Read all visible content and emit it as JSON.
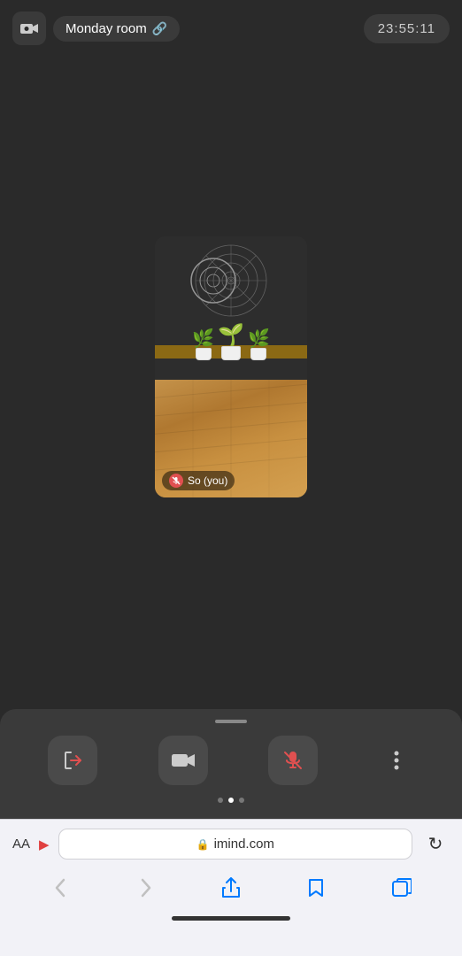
{
  "header": {
    "room_name": "Monday room",
    "time": "23:55:11",
    "camera_icon": "camera-icon",
    "link_icon": "🔗"
  },
  "video": {
    "user_name": "So  (you)",
    "muted": true,
    "mic_icon": "mic-muted-icon"
  },
  "controls": {
    "leave_label": "leave-icon",
    "camera_label": "camera-icon",
    "mic_label": "mic-icon",
    "more_label": "more-icon",
    "dots": [
      "inactive",
      "active",
      "inactive"
    ]
  },
  "browser": {
    "aa_label": "AA",
    "url": "imind.com",
    "lock_icon": "lock-icon",
    "reload_icon": "reload-icon",
    "back_icon": "‹",
    "forward_icon": "›",
    "share_icon": "share-icon",
    "bookmarks_icon": "bookmarks-icon",
    "tabs_icon": "tabs-icon"
  }
}
